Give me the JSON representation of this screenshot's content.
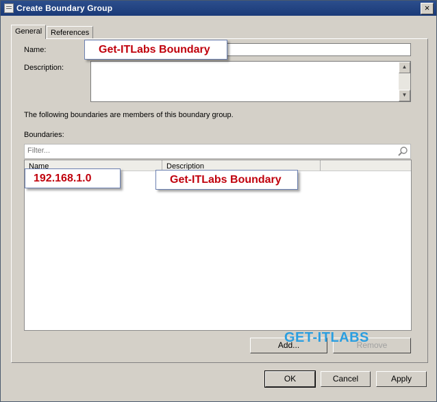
{
  "window": {
    "title": "Create Boundary Group",
    "close_glyph": "×"
  },
  "tabs": [
    {
      "label": "General"
    },
    {
      "label": "References"
    }
  ],
  "general": {
    "name_label": "Name:",
    "name_value": "Get-ITLabs Boundary",
    "description_label": "Description:",
    "description_value": "",
    "members_text": "The following boundaries are members of this boundary group.",
    "boundaries_label": "Boundaries:",
    "filter_placeholder": "Filter...",
    "columns": [
      {
        "label": "Name"
      },
      {
        "label": "Description"
      }
    ],
    "rows": [
      {
        "name": "192.168.1.0",
        "description": "Get-ITLabs Boundary"
      }
    ],
    "add_button": "Add...",
    "remove_button": "Remove"
  },
  "footer": {
    "ok": "OK",
    "cancel": "Cancel",
    "apply": "Apply"
  },
  "watermark": "GET-ITLABS",
  "icons": {
    "window": "window-icon",
    "search": "search-icon",
    "scroll_up": "scroll-up-icon",
    "scroll_down": "scroll-down-icon"
  }
}
